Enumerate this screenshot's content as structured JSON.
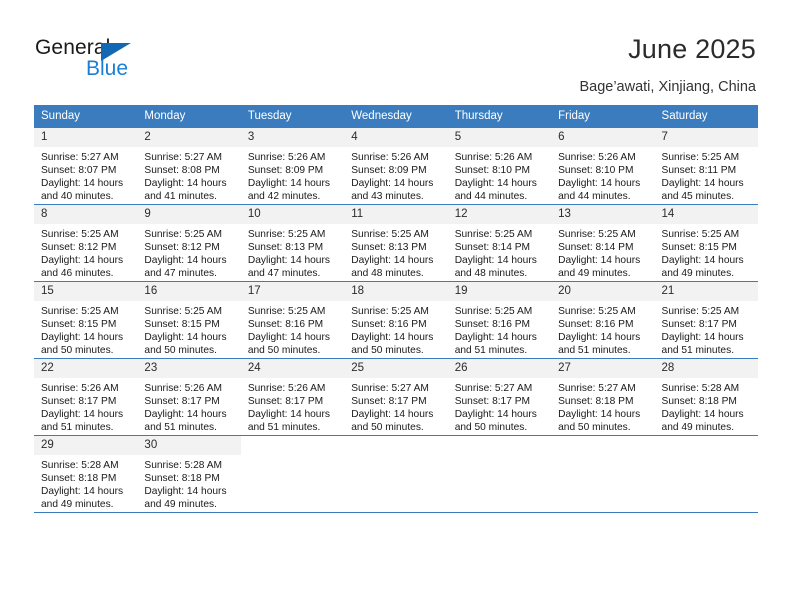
{
  "brand": {
    "name_part1": "General",
    "name_part2": "Blue",
    "color_dark": "#1a1a1a",
    "color_blue": "#1b7fd4",
    "triangle_color": "#1268b3"
  },
  "header": {
    "title": "June 2025",
    "location": "Bage’awati, Xinjiang, China"
  },
  "theme": {
    "header_bg": "#3a7cbe",
    "header_text": "#ffffff",
    "daynum_bg": "#f2f2f2",
    "cell_bg": "#ffffff",
    "grid_line": "#3a7cbe"
  },
  "columns": [
    "Sunday",
    "Monday",
    "Tuesday",
    "Wednesday",
    "Thursday",
    "Friday",
    "Saturday"
  ],
  "weeks": [
    [
      {
        "day": "1",
        "sunrise": "Sunrise: 5:27 AM",
        "sunset": "Sunset: 8:07 PM",
        "daylight1": "Daylight: 14 hours",
        "daylight2": "and 40 minutes."
      },
      {
        "day": "2",
        "sunrise": "Sunrise: 5:27 AM",
        "sunset": "Sunset: 8:08 PM",
        "daylight1": "Daylight: 14 hours",
        "daylight2": "and 41 minutes."
      },
      {
        "day": "3",
        "sunrise": "Sunrise: 5:26 AM",
        "sunset": "Sunset: 8:09 PM",
        "daylight1": "Daylight: 14 hours",
        "daylight2": "and 42 minutes."
      },
      {
        "day": "4",
        "sunrise": "Sunrise: 5:26 AM",
        "sunset": "Sunset: 8:09 PM",
        "daylight1": "Daylight: 14 hours",
        "daylight2": "and 43 minutes."
      },
      {
        "day": "5",
        "sunrise": "Sunrise: 5:26 AM",
        "sunset": "Sunset: 8:10 PM",
        "daylight1": "Daylight: 14 hours",
        "daylight2": "and 44 minutes."
      },
      {
        "day": "6",
        "sunrise": "Sunrise: 5:26 AM",
        "sunset": "Sunset: 8:10 PM",
        "daylight1": "Daylight: 14 hours",
        "daylight2": "and 44 minutes."
      },
      {
        "day": "7",
        "sunrise": "Sunrise: 5:25 AM",
        "sunset": "Sunset: 8:11 PM",
        "daylight1": "Daylight: 14 hours",
        "daylight2": "and 45 minutes."
      }
    ],
    [
      {
        "day": "8",
        "sunrise": "Sunrise: 5:25 AM",
        "sunset": "Sunset: 8:12 PM",
        "daylight1": "Daylight: 14 hours",
        "daylight2": "and 46 minutes."
      },
      {
        "day": "9",
        "sunrise": "Sunrise: 5:25 AM",
        "sunset": "Sunset: 8:12 PM",
        "daylight1": "Daylight: 14 hours",
        "daylight2": "and 47 minutes."
      },
      {
        "day": "10",
        "sunrise": "Sunrise: 5:25 AM",
        "sunset": "Sunset: 8:13 PM",
        "daylight1": "Daylight: 14 hours",
        "daylight2": "and 47 minutes."
      },
      {
        "day": "11",
        "sunrise": "Sunrise: 5:25 AM",
        "sunset": "Sunset: 8:13 PM",
        "daylight1": "Daylight: 14 hours",
        "daylight2": "and 48 minutes."
      },
      {
        "day": "12",
        "sunrise": "Sunrise: 5:25 AM",
        "sunset": "Sunset: 8:14 PM",
        "daylight1": "Daylight: 14 hours",
        "daylight2": "and 48 minutes."
      },
      {
        "day": "13",
        "sunrise": "Sunrise: 5:25 AM",
        "sunset": "Sunset: 8:14 PM",
        "daylight1": "Daylight: 14 hours",
        "daylight2": "and 49 minutes."
      },
      {
        "day": "14",
        "sunrise": "Sunrise: 5:25 AM",
        "sunset": "Sunset: 8:15 PM",
        "daylight1": "Daylight: 14 hours",
        "daylight2": "and 49 minutes."
      }
    ],
    [
      {
        "day": "15",
        "sunrise": "Sunrise: 5:25 AM",
        "sunset": "Sunset: 8:15 PM",
        "daylight1": "Daylight: 14 hours",
        "daylight2": "and 50 minutes."
      },
      {
        "day": "16",
        "sunrise": "Sunrise: 5:25 AM",
        "sunset": "Sunset: 8:15 PM",
        "daylight1": "Daylight: 14 hours",
        "daylight2": "and 50 minutes."
      },
      {
        "day": "17",
        "sunrise": "Sunrise: 5:25 AM",
        "sunset": "Sunset: 8:16 PM",
        "daylight1": "Daylight: 14 hours",
        "daylight2": "and 50 minutes."
      },
      {
        "day": "18",
        "sunrise": "Sunrise: 5:25 AM",
        "sunset": "Sunset: 8:16 PM",
        "daylight1": "Daylight: 14 hours",
        "daylight2": "and 50 minutes."
      },
      {
        "day": "19",
        "sunrise": "Sunrise: 5:25 AM",
        "sunset": "Sunset: 8:16 PM",
        "daylight1": "Daylight: 14 hours",
        "daylight2": "and 51 minutes."
      },
      {
        "day": "20",
        "sunrise": "Sunrise: 5:25 AM",
        "sunset": "Sunset: 8:16 PM",
        "daylight1": "Daylight: 14 hours",
        "daylight2": "and 51 minutes."
      },
      {
        "day": "21",
        "sunrise": "Sunrise: 5:25 AM",
        "sunset": "Sunset: 8:17 PM",
        "daylight1": "Daylight: 14 hours",
        "daylight2": "and 51 minutes."
      }
    ],
    [
      {
        "day": "22",
        "sunrise": "Sunrise: 5:26 AM",
        "sunset": "Sunset: 8:17 PM",
        "daylight1": "Daylight: 14 hours",
        "daylight2": "and 51 minutes."
      },
      {
        "day": "23",
        "sunrise": "Sunrise: 5:26 AM",
        "sunset": "Sunset: 8:17 PM",
        "daylight1": "Daylight: 14 hours",
        "daylight2": "and 51 minutes."
      },
      {
        "day": "24",
        "sunrise": "Sunrise: 5:26 AM",
        "sunset": "Sunset: 8:17 PM",
        "daylight1": "Daylight: 14 hours",
        "daylight2": "and 51 minutes."
      },
      {
        "day": "25",
        "sunrise": "Sunrise: 5:27 AM",
        "sunset": "Sunset: 8:17 PM",
        "daylight1": "Daylight: 14 hours",
        "daylight2": "and 50 minutes."
      },
      {
        "day": "26",
        "sunrise": "Sunrise: 5:27 AM",
        "sunset": "Sunset: 8:17 PM",
        "daylight1": "Daylight: 14 hours",
        "daylight2": "and 50 minutes."
      },
      {
        "day": "27",
        "sunrise": "Sunrise: 5:27 AM",
        "sunset": "Sunset: 8:18 PM",
        "daylight1": "Daylight: 14 hours",
        "daylight2": "and 50 minutes."
      },
      {
        "day": "28",
        "sunrise": "Sunrise: 5:28 AM",
        "sunset": "Sunset: 8:18 PM",
        "daylight1": "Daylight: 14 hours",
        "daylight2": "and 49 minutes."
      }
    ],
    [
      {
        "day": "29",
        "sunrise": "Sunrise: 5:28 AM",
        "sunset": "Sunset: 8:18 PM",
        "daylight1": "Daylight: 14 hours",
        "daylight2": "and 49 minutes."
      },
      {
        "day": "30",
        "sunrise": "Sunrise: 5:28 AM",
        "sunset": "Sunset: 8:18 PM",
        "daylight1": "Daylight: 14 hours",
        "daylight2": "and 49 minutes."
      },
      {
        "day": "",
        "sunrise": "",
        "sunset": "",
        "daylight1": "",
        "daylight2": ""
      },
      {
        "day": "",
        "sunrise": "",
        "sunset": "",
        "daylight1": "",
        "daylight2": ""
      },
      {
        "day": "",
        "sunrise": "",
        "sunset": "",
        "daylight1": "",
        "daylight2": ""
      },
      {
        "day": "",
        "sunrise": "",
        "sunset": "",
        "daylight1": "",
        "daylight2": ""
      },
      {
        "day": "",
        "sunrise": "",
        "sunset": "",
        "daylight1": "",
        "daylight2": ""
      }
    ]
  ]
}
